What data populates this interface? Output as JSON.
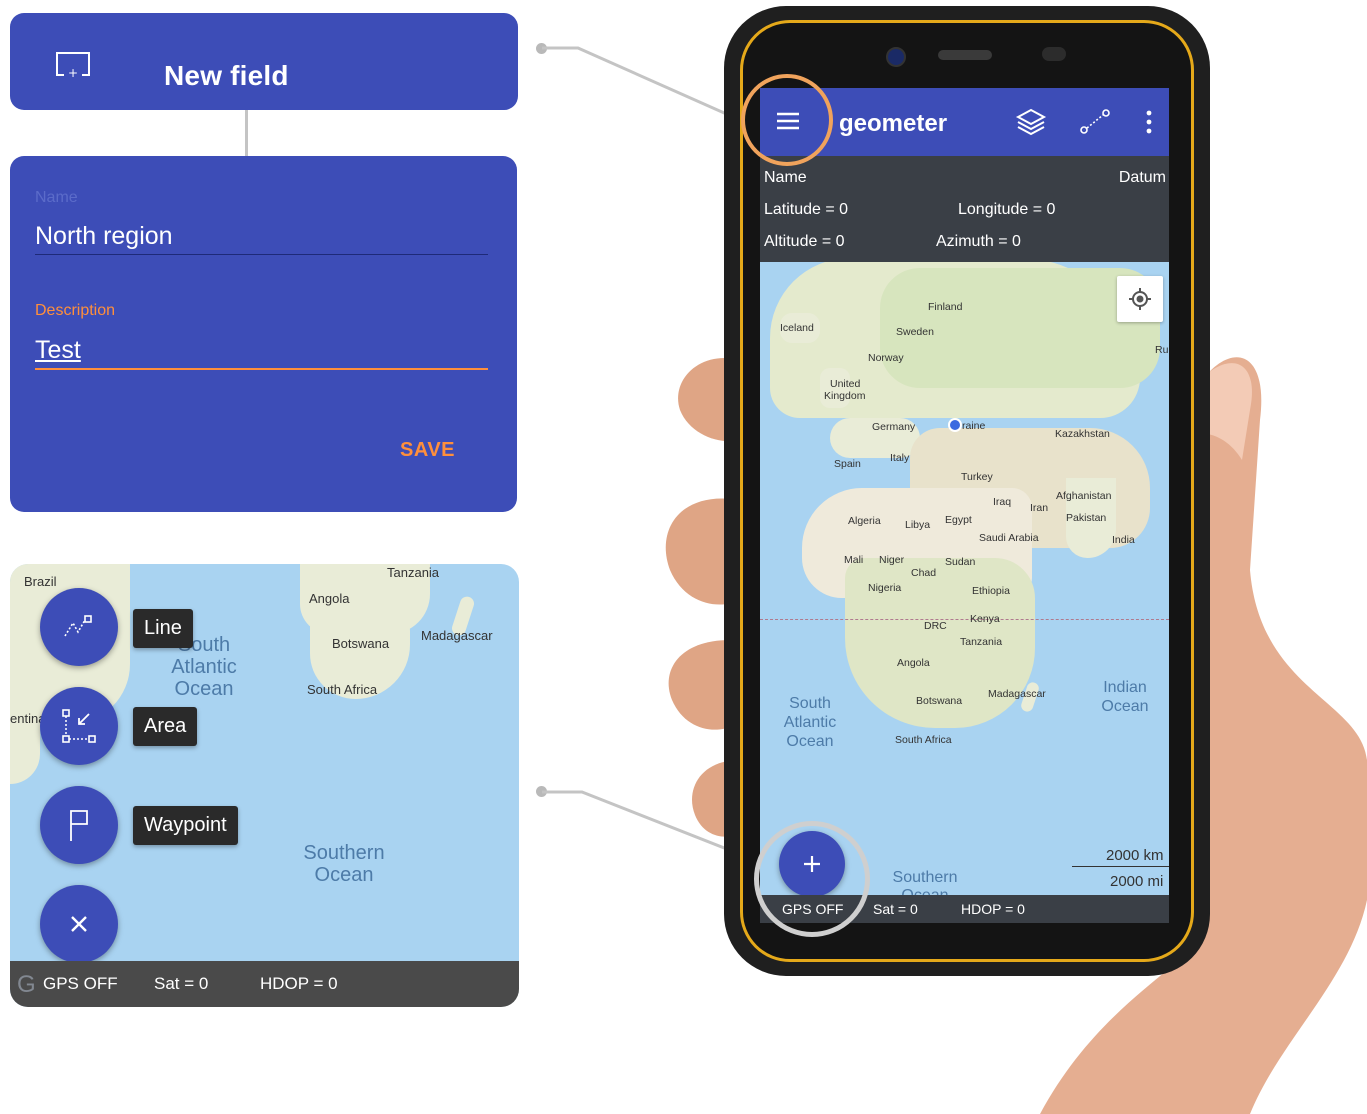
{
  "new_field": {
    "title": "New field",
    "icon": "add-field-icon"
  },
  "form": {
    "name_label": "Name",
    "name_value": "North region",
    "description_label": "Description",
    "description_value": "Test",
    "save_label": "SAVE",
    "accent_color": "#ff8f3b"
  },
  "fab_menu": {
    "line_label": "Line",
    "area_label": "Area",
    "waypoint_label": "Waypoint",
    "close_icon": "close-icon"
  },
  "map_card": {
    "labels": {
      "brazil": "Brazil",
      "tanzania": "Tanzania",
      "angola": "Angola",
      "botswana": "Botswana",
      "madagascar": "Madagascar",
      "south_africa": "South Africa",
      "argentina": "entina"
    },
    "oceans": {
      "south_atlantic_1": "South",
      "south_atlantic_2": "Atlantic",
      "south_atlantic_3": "Ocean",
      "southern_1": "Southern",
      "southern_2": "Ocean"
    },
    "status": {
      "gps": "GPS OFF",
      "sat": "Sat = 0",
      "hdop": "HDOP = 0",
      "google": "G"
    }
  },
  "phone": {
    "app_title": "geometer",
    "info": {
      "name": "Name",
      "datum": "Datum",
      "latitude": "Latitude = 0",
      "longitude": "Longitude = 0",
      "altitude": "Altitude = 0",
      "azimuth": "Azimuth = 0"
    },
    "map_labels": {
      "finland": "Finland",
      "iceland": "Iceland",
      "sweden": "Sweden",
      "norway": "Norway",
      "russia": "Ru",
      "uk_1": "United",
      "uk_2": "Kingdom",
      "germany": "Germany",
      "ukraine": "raine",
      "kazakhstan": "Kazakhstan",
      "spain": "Spain",
      "italy": "Italy",
      "turkey": "Turkey",
      "afghanistan": "Afghanistan",
      "iraq": "Iraq",
      "iran": "Iran",
      "pakistan": "Pakistan",
      "algeria": "Algeria",
      "libya": "Libya",
      "egypt": "Egypt",
      "saudi": "Saudi Arabia",
      "india": "India",
      "mali": "Mali",
      "niger": "Niger",
      "chad": "Chad",
      "sudan": "Sudan",
      "nigeria": "Nigeria",
      "ethiopia": "Ethiopia",
      "kenya": "Kenya",
      "drc": "DRC",
      "tanzania": "Tanzania",
      "angola": "Angola",
      "botswana": "Botswana",
      "madagascar": "Madagascar",
      "south_africa": "South Africa"
    },
    "oceans": {
      "sa_1": "South",
      "sa_2": "Atlantic",
      "sa_3": "Ocean",
      "io_1": "Indian",
      "io_2": "Ocean",
      "so_1": "Southern",
      "so_2": "Ocean"
    },
    "scale": {
      "km": "2000 km",
      "mi": "2000 mi"
    },
    "status": {
      "gps": "GPS OFF",
      "sat": "Sat = 0",
      "hdop": "HDOP = 0"
    },
    "fab_icon": "plus-icon",
    "highlight_color": "#f0a35c"
  }
}
